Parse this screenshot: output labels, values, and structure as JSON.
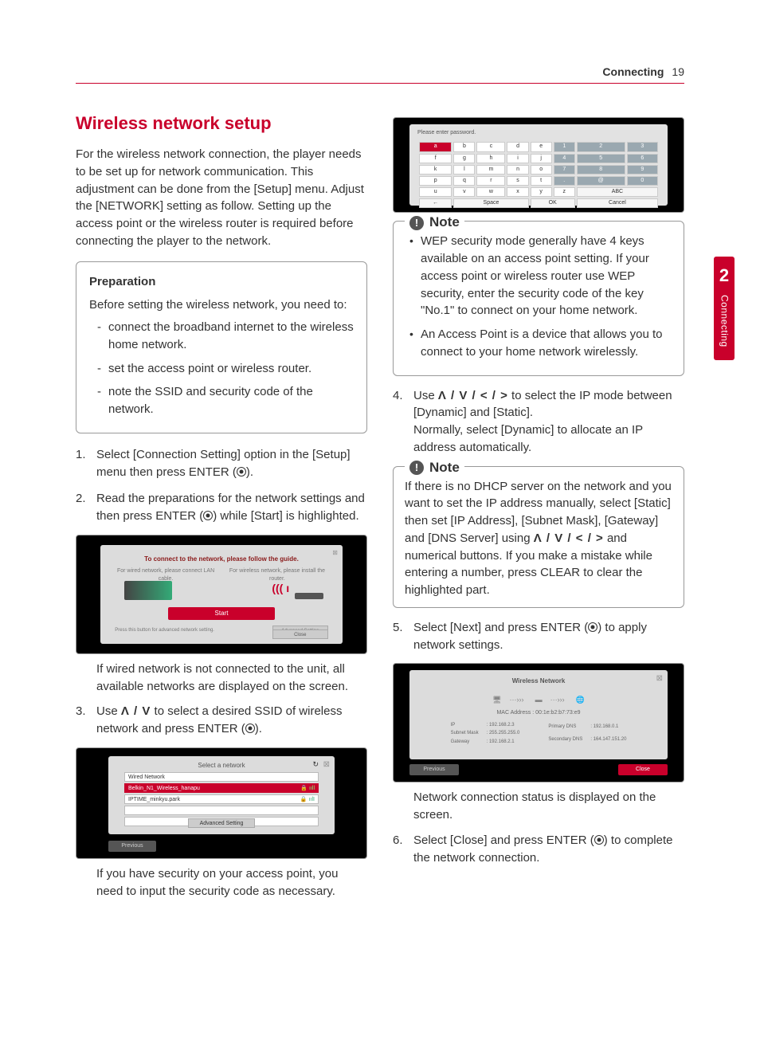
{
  "header": {
    "section": "Connecting",
    "page": "19"
  },
  "side_tab": {
    "number": "2",
    "label": "Connecting"
  },
  "title": "Wireless network setup",
  "intro": "For the wireless network connection, the player needs to be set up for network communication. This adjustment can be done from the [Setup] menu. Adjust the [NETWORK] setting as follow. Setting up the access point or the wireless router is required before connecting the player to the network.",
  "prep": {
    "heading": "Preparation",
    "lead": "Before setting the wireless network, you need to:",
    "items": [
      "connect the broadband internet to the wireless home network.",
      "set the access point or wireless router.",
      "note the SSID and security code of the network."
    ]
  },
  "steps": [
    {
      "n": "1.",
      "text_a": "Select [Connection Setting] option in the [Setup] menu then press ENTER (",
      "text_b": ")."
    },
    {
      "n": "2.",
      "text_a": "Read the preparations for the network settings and then press ENTER (",
      "text_b": ") while [Start] is highlighted."
    }
  ],
  "shot1": {
    "guide": "To connect to the network, please follow the guide.",
    "wired_hint": "For wired network, please connect LAN cable.",
    "wireless_hint": "For wireless network, please install the router.",
    "start": "Start",
    "adv_text": "Press this button for advanced network setting.",
    "advanced": "Advanced Setting",
    "close": "Close"
  },
  "after_shot1": "If wired network is not connected to the unit, all available networks are displayed on the screen.",
  "step3": {
    "n": "3.",
    "pre": "Use ",
    "arrows": "Ʌ / V",
    "post": " to select a desired SSID of wireless network and press ENTER (",
    "tail": ")."
  },
  "shot2": {
    "title": "Select a network",
    "wired": "Wired Network",
    "ssid1": "Belkin_N1_Wireless_hanapu",
    "ssid2": "IPTIME_minkyu.park",
    "advanced": "Advanced Setting",
    "previous": "Previous"
  },
  "after_shot2": "If you have security on your access point, you need to input the security code as necessary.",
  "shot3": {
    "prompt": "Please enter password.",
    "keys": [
      [
        "a",
        "b",
        "c",
        "d",
        "e",
        "1",
        "2",
        "3"
      ],
      [
        "f",
        "g",
        "h",
        "i",
        "j",
        "4",
        "5",
        "6"
      ],
      [
        "k",
        "l",
        "m",
        "n",
        "o",
        "7",
        "8",
        "9"
      ],
      [
        "p",
        "q",
        "r",
        "s",
        "t",
        ".",
        "@",
        "0"
      ],
      [
        "u",
        "v",
        "w",
        "x",
        "y",
        "z",
        "ABC",
        ""
      ]
    ],
    "row_bottom": [
      "←",
      "Space",
      "OK",
      "Cancel"
    ]
  },
  "note1": {
    "title": "Note",
    "bullets": [
      "WEP security mode generally have 4 keys available on an access point setting. If your access point or wireless router use WEP security, enter the security code of the key \"No.1\" to connect on your home network.",
      "An Access Point is a device that allows you to connect to your home network wirelessly."
    ]
  },
  "step4": {
    "n": "4.",
    "pre": "Use ",
    "arrows": "Ʌ / V / < / >",
    "post": " to select the IP mode between [Dynamic] and [Static].",
    "line2": "Normally, select [Dynamic] to allocate an IP address automatically."
  },
  "note2": {
    "title": "Note",
    "text_a": "If there is no DHCP server on the network and you want to set the IP address manually, select [Static] then set [IP Address], [Subnet Mask], [Gateway] and [DNS Server] using ",
    "arrows": "Ʌ / V / < / >",
    "text_b": " and numerical buttons. If you make a mistake while entering a number, press CLEAR to clear the highlighted part."
  },
  "step5": {
    "n": "5.",
    "text_a": "Select [Next] and press ENTER (",
    "text_b": ") to apply network settings."
  },
  "shot4": {
    "title": "Wireless Network",
    "mac_label": "MAC Address :",
    "mac": "00:1e:b2:b7:73:e9",
    "left_rows": [
      [
        "IP",
        ": 192.168.2.3"
      ],
      [
        "Subnet Mask",
        ": 255.255.255.0"
      ],
      [
        "Gateway",
        ": 192.168.2.1"
      ]
    ],
    "right_rows": [
      [
        "Primary DNS",
        ": 192.168.0.1"
      ],
      [
        "Secondary DNS",
        ": 164.147.151.20"
      ]
    ],
    "previous": "Previous",
    "close": "Close"
  },
  "after_shot4": "Network connection status is displayed on the screen.",
  "step6": {
    "n": "6.",
    "text_a": "Select [Close] and press ENTER (",
    "text_b": ") to complete the network connection."
  }
}
